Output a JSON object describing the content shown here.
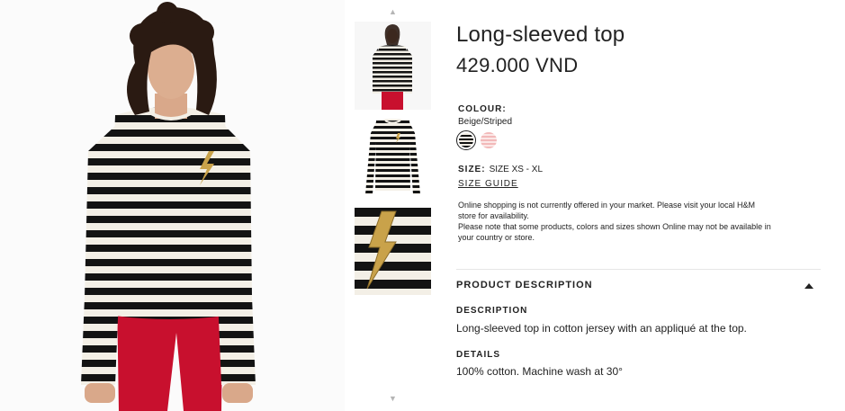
{
  "product": {
    "title": "Long-sleeved top",
    "price": "429.000 VND"
  },
  "colour": {
    "label": "COLOUR:",
    "selected": "Beige/Striped",
    "swatches": [
      {
        "name": "Beige/Striped",
        "color": "#111111",
        "stripe": "#f2ede3",
        "selected": true
      },
      {
        "name": "Pink/Striped",
        "color": "#f2b9b9",
        "stripe": "#fbe7e6",
        "selected": false
      }
    ]
  },
  "size": {
    "label": "SIZE:",
    "value": "SIZE XS - XL",
    "guide_link": "SIZE GUIDE"
  },
  "notice": {
    "line1": "Online shopping is not currently offered in your market. Please visit your local H&M store for availability.",
    "line2": "Please note that some products, colors and sizes shown Online may not be available in your country or store."
  },
  "product_description": {
    "header": "PRODUCT DESCRIPTION",
    "description_label": "DESCRIPTION",
    "description_text": "Long-sleeved top in cotton jersey with an appliqué at the top.",
    "details_label": "DETAILS",
    "details_text": "100% cotton. Machine wash at 30°"
  },
  "thumbnails": {
    "up_arrow": "▲",
    "down_arrow": "▼"
  },
  "colors": {
    "stripe_dark": "#111111",
    "stripe_light": "#f2ede3",
    "trousers_red": "#c8102e",
    "applique_gold": "#c9a24a"
  }
}
